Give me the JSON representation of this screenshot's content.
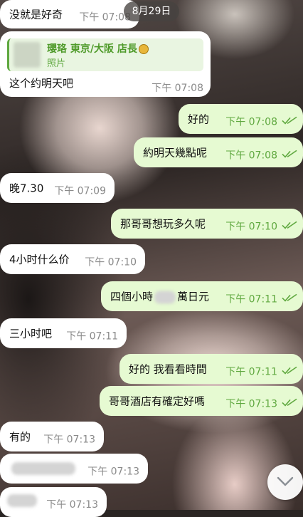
{
  "date_pill": "8月29日",
  "reply": {
    "sender": "瓔珞 東京/大阪 店長",
    "medal_icon": "gold-medal-icon",
    "attachment": "照片",
    "text": "这个约明天吧",
    "time": "下午 07:08"
  },
  "messages": [
    {
      "dir": "in",
      "text": "没就是好奇",
      "time": "下午 07:08"
    },
    {
      "dir": "out",
      "text": "好的",
      "time": "下午 07:08"
    },
    {
      "dir": "out",
      "text": "約明天幾點呢",
      "time": "下午 07:08"
    },
    {
      "dir": "in",
      "text": "晚7.30",
      "time": "下午 07:09"
    },
    {
      "dir": "out",
      "text": "那哥哥想玩多久呢",
      "time": "下午 07:10"
    },
    {
      "dir": "in",
      "text": "4小时什么价",
      "time": "下午 07:10"
    },
    {
      "dir": "out",
      "text_before": "四個小時",
      "text_after": "萬日元",
      "time": "下午 07:11"
    },
    {
      "dir": "in",
      "text": "三小时吧",
      "time": "下午 07:11"
    },
    {
      "dir": "out",
      "text": "好的 我看看時間",
      "time": "下午 07:11"
    },
    {
      "dir": "out",
      "text": "哥哥酒店有確定好嗎",
      "time": "下午 07:13"
    },
    {
      "dir": "in",
      "text": "有的",
      "time": "下午 07:13"
    },
    {
      "dir": "in",
      "text": "",
      "time": "下午 07:13"
    },
    {
      "dir": "in",
      "text": "",
      "time": "下午 07:13"
    }
  ],
  "colors": {
    "incoming": "#ffffff",
    "outgoing": "#e6fad2",
    "accent": "#5fa83f"
  },
  "icons": {
    "read": "double-check-icon",
    "scroll": "chevron-down-icon"
  }
}
